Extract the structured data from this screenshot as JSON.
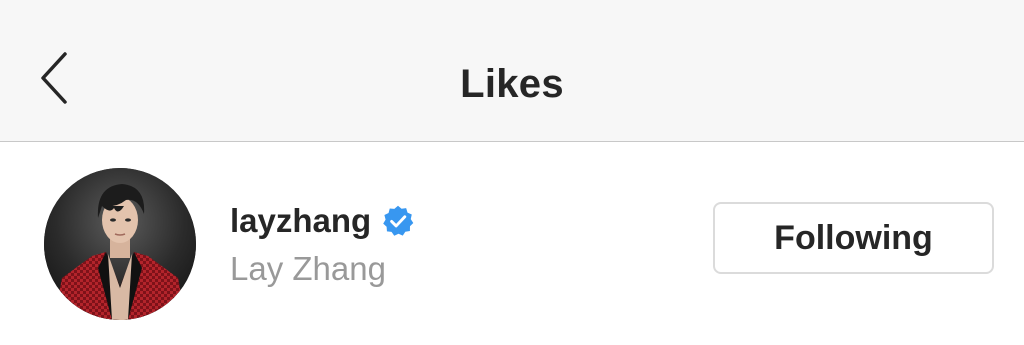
{
  "header": {
    "title": "Likes",
    "back_icon": "chevron-left-icon"
  },
  "user": {
    "username": "layzhang",
    "full_name": "Lay Zhang",
    "verified": true,
    "verified_icon": "verified-badge-icon",
    "avatar": "profile-photo",
    "follow_button_label": "Following"
  },
  "colors": {
    "header_bg": "#f7f7f7",
    "text_primary": "#262626",
    "text_secondary": "#999999",
    "verified_blue": "#3897f0",
    "button_border": "#dbdbdb"
  }
}
